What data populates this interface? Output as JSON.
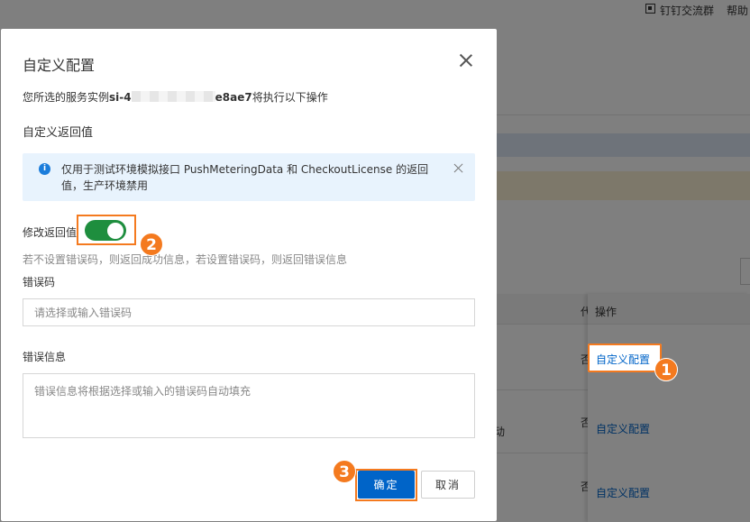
{
  "background": {
    "topbar": {
      "dingtalk_group": "钉钉交流群",
      "help": "帮助"
    },
    "table": {
      "col_partial": "代",
      "col_actions": "操作",
      "rows": [
        {
          "partial_value": "否",
          "action": "自定义配置",
          "extra": ""
        },
        {
          "partial_value": "否",
          "action": "自定义配置",
          "extra": "动"
        },
        {
          "partial_value": "否",
          "action": "自定义配置",
          "extra": ""
        }
      ]
    }
  },
  "dialog": {
    "title": "自定义配置",
    "instance_prefix": "您所选的服务实例",
    "instance_id_start": "si-4",
    "instance_id_end": "e8ae7",
    "instance_suffix": "将执行以下操作",
    "section_title": "自定义返回值",
    "notice": "仅用于测试环境模拟接口 PushMeteringData 和 CheckoutLicense 的返回值，生产环境禁用",
    "modify_label": "修改返回值",
    "modify_enabled": true,
    "hint": "若不设置错误码，则返回成功信息，若设置错误码，则返回错误信息",
    "error_code_label": "错误码",
    "error_code_placeholder": "请选择或输入错误码",
    "error_msg_label": "错误信息",
    "error_msg_placeholder": "错误信息将根据选择或输入的错误码自动填充",
    "confirm": "确定",
    "cancel": "取消"
  },
  "callouts": [
    "1",
    "2",
    "3"
  ],
  "colors": {
    "accent": "#0064c8",
    "callout": "#f47a1f",
    "toggle_on": "#1e8e3e",
    "notice_bg": "#e8f3fd"
  }
}
